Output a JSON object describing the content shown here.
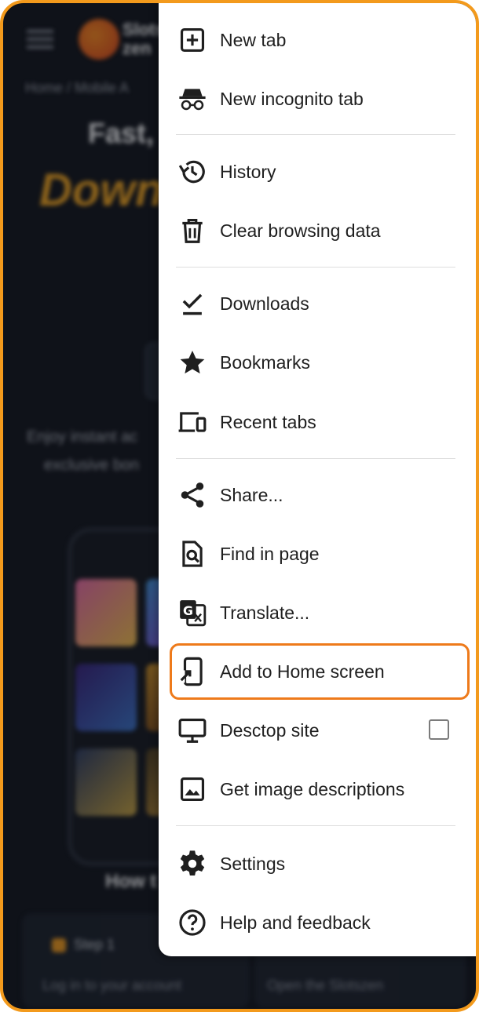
{
  "background": {
    "logo_text": "Slots\nzen",
    "breadcrumb": "Home / Mobile A",
    "headline": "Fast,",
    "headline_accent": "Down",
    "promo_line1": "Enjoy instant ac",
    "promo_line2": "exclusive bon",
    "how_title": "How t",
    "step_label": "Step 1",
    "step1_text": "Log in to your account",
    "step2_text": "Open the Slotszen"
  },
  "menu": {
    "items": [
      {
        "label": "New tab",
        "icon": "new-tab-icon"
      },
      {
        "label": "New incognito tab",
        "icon": "incognito-icon"
      },
      {
        "label": "History",
        "icon": "history-icon"
      },
      {
        "label": "Clear browsing data",
        "icon": "trash-icon"
      },
      {
        "label": "Downloads",
        "icon": "download-icon"
      },
      {
        "label": "Bookmarks",
        "icon": "star-icon"
      },
      {
        "label": "Recent tabs",
        "icon": "devices-icon"
      },
      {
        "label": "Share...",
        "icon": "share-icon"
      },
      {
        "label": "Find in page",
        "icon": "find-in-page-icon"
      },
      {
        "label": "Translate...",
        "icon": "translate-icon"
      },
      {
        "label": "Add to Home screen",
        "icon": "add-to-home-icon"
      },
      {
        "label": "Desctop site",
        "icon": "desktop-icon",
        "checked": false
      },
      {
        "label": "Get image descriptions",
        "icon": "image-icon"
      },
      {
        "label": "Settings",
        "icon": "gear-icon"
      },
      {
        "label": "Help and feedback",
        "icon": "help-icon"
      }
    ]
  },
  "colors": {
    "frame": "#f39a1c",
    "highlight": "#ee7a1a",
    "background_page": "#0f1219"
  }
}
